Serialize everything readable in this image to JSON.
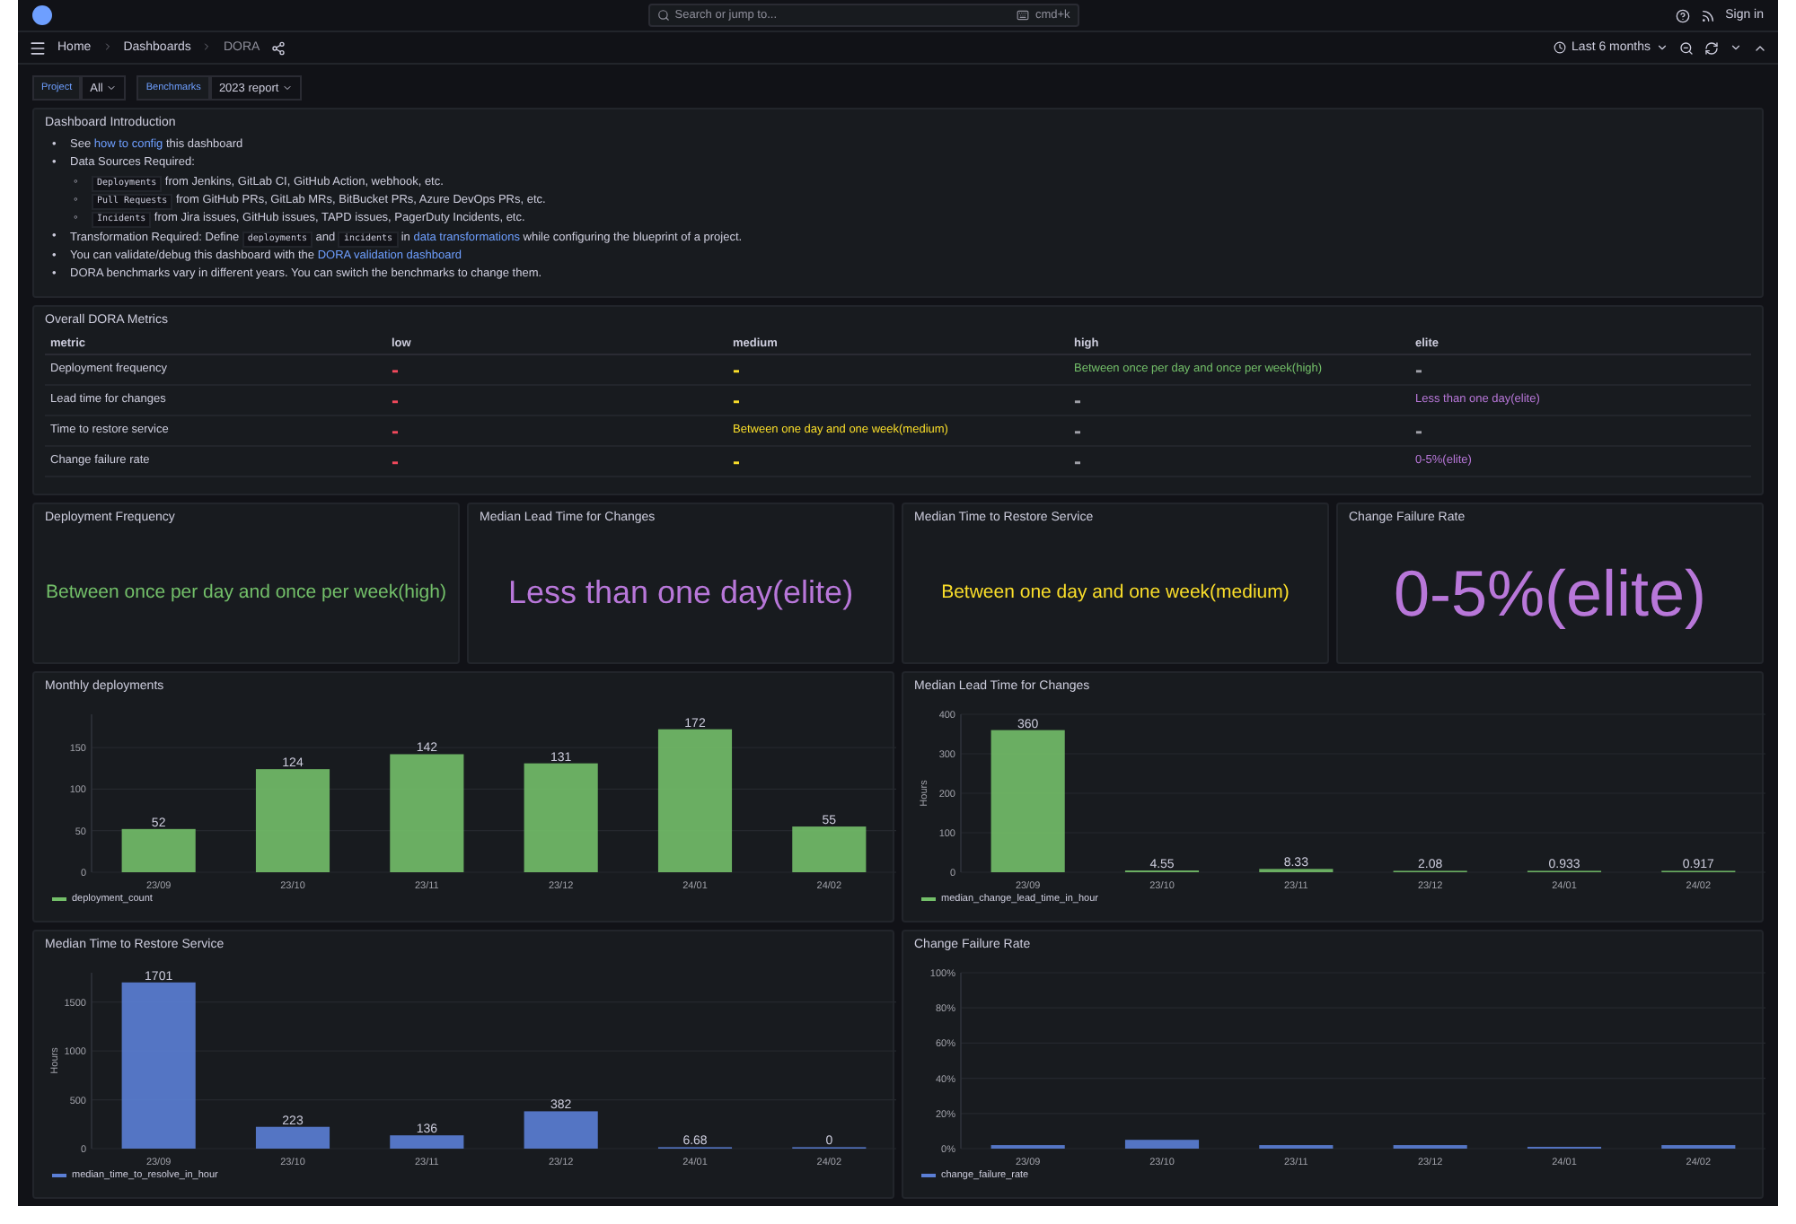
{
  "top_bar": {
    "search_placeholder": "Search or jump to...",
    "search_shortcut": "cmd+k",
    "sign_in": "Sign in"
  },
  "breadcrumbs": [
    "Home",
    "Dashboards",
    "DORA"
  ],
  "time_range": "Last 6 months",
  "variables": [
    {
      "label": "Project",
      "value": "All"
    },
    {
      "label": "Benchmarks",
      "value": "2023 report"
    }
  ],
  "intro": {
    "title": "Dashboard Introduction",
    "items": [
      {
        "marker": "•",
        "parts": [
          {
            "kind": "text",
            "text": "See "
          },
          {
            "kind": "link",
            "text": "how to config"
          },
          {
            "kind": "text",
            "text": " this dashboard"
          }
        ]
      },
      {
        "marker": "•",
        "parts": [
          {
            "kind": "text",
            "text": "Data Sources Required:"
          }
        ],
        "children": [
          {
            "marker": "◦",
            "parts": [
              {
                "kind": "code",
                "text": "Deployments"
              },
              {
                "kind": "text",
                "text": " from Jenkins, GitLab CI, GitHub Action, webhook, etc."
              }
            ]
          },
          {
            "marker": "◦",
            "parts": [
              {
                "kind": "code",
                "text": "Pull Requests"
              },
              {
                "kind": "text",
                "text": " from GitHub PRs, GitLab MRs, BitBucket PRs, Azure DevOps PRs, etc."
              }
            ]
          },
          {
            "marker": "◦",
            "parts": [
              {
                "kind": "code",
                "text": "Incidents"
              },
              {
                "kind": "text",
                "text": " from Jira issues, GitHub issues, TAPD issues, PagerDuty Incidents, etc."
              }
            ]
          }
        ]
      },
      {
        "marker": "•",
        "parts": [
          {
            "kind": "text",
            "text": "Transformation Required: Define "
          },
          {
            "kind": "code",
            "text": "deployments"
          },
          {
            "kind": "text",
            "text": " and "
          },
          {
            "kind": "code",
            "text": "incidents"
          },
          {
            "kind": "text",
            "text": " in "
          },
          {
            "kind": "link",
            "text": "data transformations"
          },
          {
            "kind": "text",
            "text": " while configuring the blueprint of a project."
          }
        ]
      },
      {
        "marker": "•",
        "parts": [
          {
            "kind": "text",
            "text": "You can validate/debug this dashboard with the "
          },
          {
            "kind": "link",
            "text": "DORA validation dashboard"
          }
        ]
      },
      {
        "marker": "•",
        "parts": [
          {
            "kind": "text",
            "text": "DORA benchmarks vary in different years. You can switch the benchmarks to change them."
          }
        ]
      }
    ]
  },
  "metrics_table": {
    "title": "Overall DORA Metrics",
    "columns": [
      "metric",
      "low",
      "medium",
      "high",
      "elite"
    ],
    "rows": [
      {
        "cells": [
          {
            "text": "Deployment frequency",
            "color": "#ccccdc"
          },
          {
            "text": "-",
            "color": "#f2495c"
          },
          {
            "text": "-",
            "color": "#fade2a"
          },
          {
            "text": "Between once per day and once per week(high)",
            "color": "#73bf69"
          },
          {
            "text": "-",
            "color": "#9fa0a8"
          }
        ]
      },
      {
        "cells": [
          {
            "text": "Lead time for changes",
            "color": "#ccccdc"
          },
          {
            "text": "-",
            "color": "#f2495c"
          },
          {
            "text": "-",
            "color": "#fade2a"
          },
          {
            "text": "-",
            "color": "#9fa0a8"
          },
          {
            "text": "Less than one day(elite)",
            "color": "#b877d9"
          }
        ]
      },
      {
        "cells": [
          {
            "text": "Time to restore service",
            "color": "#ccccdc"
          },
          {
            "text": "-",
            "color": "#f2495c"
          },
          {
            "text": "Between one day and one week(medium)",
            "color": "#fade2a"
          },
          {
            "text": "-",
            "color": "#9fa0a8"
          },
          {
            "text": "-",
            "color": "#9fa0a8"
          }
        ]
      },
      {
        "cells": [
          {
            "text": "Change failure rate",
            "color": "#ccccdc"
          },
          {
            "text": "-",
            "color": "#f2495c"
          },
          {
            "text": "-",
            "color": "#fade2a"
          },
          {
            "text": "-",
            "color": "#9fa0a8"
          },
          {
            "text": "0-5%(elite)",
            "color": "#b877d9"
          }
        ]
      }
    ]
  },
  "stats": [
    {
      "title": "Deployment Frequency",
      "value": "Between once per day and once per week(high)",
      "color": "#73bf69"
    },
    {
      "title": "Median Lead Time for Changes",
      "value": "Less than one day(elite)",
      "color": "#b877d9"
    },
    {
      "title": "Median Time to Restore Service",
      "value": "Between one day and one week(medium)",
      "color": "#fade2a"
    },
    {
      "title": "Change Failure Rate",
      "value": "0-5%(elite)",
      "color": "#b877d9"
    }
  ],
  "charts": [
    {
      "title": "Monthly deployments",
      "chart_data": {
        "type": "bar",
        "categories": [
          "23/09",
          "23/10",
          "23/11",
          "23/12",
          "24/01",
          "24/02"
        ],
        "series": [
          {
            "name": "deployment_count",
            "color": "#73bf69",
            "values": [
              52,
              124,
              142,
              131,
              172,
              55
            ]
          }
        ],
        "grid": true,
        "ylim": [
          0,
          190
        ],
        "yticks": [
          0,
          50,
          100,
          150
        ],
        "data_labels": true
      }
    },
    {
      "title": "Median Lead Time for Changes",
      "chart_data": {
        "type": "bar",
        "ylabel": "Hours",
        "categories": [
          "23/09",
          "23/10",
          "23/11",
          "23/12",
          "24/01",
          "24/02"
        ],
        "series": [
          {
            "name": "median_change_lead_time_in_hour",
            "color": "#73bf69",
            "values": [
              360,
              4.55,
              8.33,
              2.08,
              0.933,
              0.917
            ]
          }
        ],
        "grid": true,
        "ylim": [
          0,
          400
        ],
        "yticks": [
          0,
          100,
          200,
          300,
          400
        ],
        "data_labels": true
      }
    },
    {
      "title": "Median Time to Restore Service",
      "chart_data": {
        "type": "bar",
        "ylabel": "Hours",
        "categories": [
          "23/09",
          "23/10",
          "23/11",
          "23/12",
          "24/01",
          "24/02"
        ],
        "series": [
          {
            "name": "median_time_to_resolve_in_hour",
            "color": "#5b7fd6",
            "values": [
              1701,
              223,
              136,
              382,
              6.68,
              0
            ]
          }
        ],
        "grid": true,
        "ylim": [
          0,
          1800
        ],
        "yticks": [
          0,
          500,
          1000,
          1500
        ],
        "data_labels": true
      }
    },
    {
      "title": "Change Failure Rate",
      "chart_data": {
        "type": "bar",
        "categories": [
          "23/09",
          "23/10",
          "23/11",
          "23/12",
          "24/01",
          "24/02"
        ],
        "series": [
          {
            "name": "change_failure_rate",
            "color": "#5b7fd6",
            "values": [
              2,
              5,
              2,
              2,
              1,
              2
            ]
          }
        ],
        "grid": true,
        "ylim": [
          0,
          100
        ],
        "yticks": [
          {
            "value": 0,
            "label": "0%"
          },
          {
            "value": 20,
            "label": "20%"
          },
          {
            "value": 40,
            "label": "40%"
          },
          {
            "value": 60,
            "label": "60%"
          },
          {
            "value": 80,
            "label": "80%"
          },
          {
            "value": 100,
            "label": "100%"
          }
        ]
      }
    }
  ]
}
